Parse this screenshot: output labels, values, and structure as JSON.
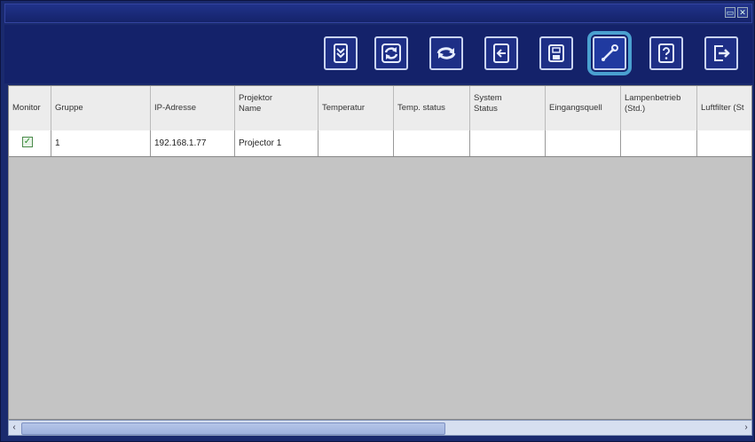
{
  "titlebar": {
    "minimize_glyph": "▭",
    "close_glyph": "✕"
  },
  "toolbar": {
    "buttons": [
      {
        "name": "collapse-icon",
        "active": false
      },
      {
        "name": "refresh-icon",
        "active": false
      },
      {
        "name": "sync-icon",
        "active": false
      },
      {
        "name": "input-source-icon",
        "active": false
      },
      {
        "name": "save-icon",
        "active": false
      },
      {
        "name": "tools-icon",
        "active": true
      },
      {
        "name": "help-icon",
        "active": false
      },
      {
        "name": "exit-icon",
        "active": false
      }
    ]
  },
  "table": {
    "headers": {
      "monitor": "Monitor",
      "gruppe": "Gruppe",
      "ip": "IP-Adresse",
      "name": "Projektor\nName",
      "temperatur": "Temperatur",
      "temp_status": "Temp. status",
      "system_status": "System\nStatus",
      "eingangsquelle": "Eingangsquell",
      "lampenbetrieb": "Lampenbetrieb\n(Std.)",
      "luftfilter": "Luftfilter (St"
    },
    "rows": [
      {
        "monitor_checked": true,
        "gruppe": "1",
        "ip": "192.168.1.77",
        "name": "Projector 1",
        "temperatur": "",
        "temp_status": "",
        "system_status": "",
        "eingangsquelle": "",
        "lampenbetrieb": "",
        "luftfilter": ""
      }
    ]
  },
  "scrollbar": {
    "left_arrow": "‹",
    "right_arrow": "›"
  }
}
